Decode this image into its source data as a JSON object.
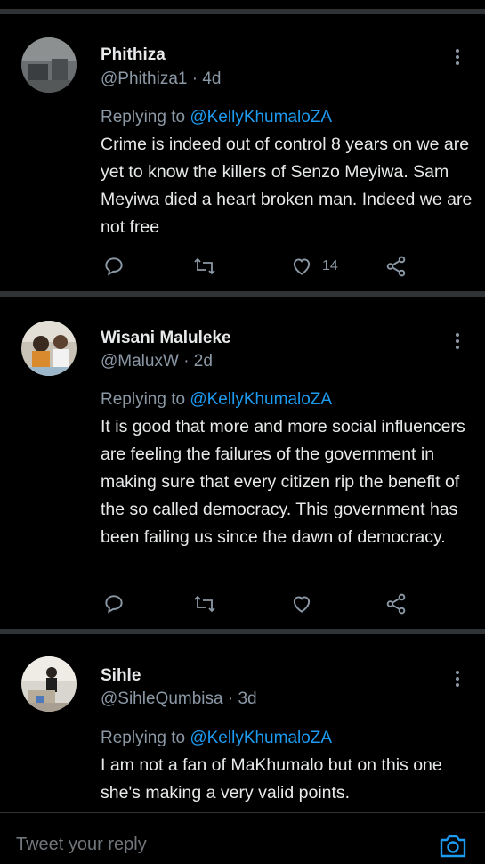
{
  "tweets": [
    {
      "name": "Phithiza",
      "handle": "@Phithiza1",
      "sep": "·",
      "age": "4d",
      "replying_prefix": "Replying to ",
      "replying_handle": "@KellyKhumaloZA",
      "text": "Crime is indeed out of control 8 years on we are yet to know the killers of Senzo Meyiwa. Sam Meyiwa died a heart broken man. Indeed we are not free",
      "like_count": "14"
    },
    {
      "name": "Wisani Maluleke",
      "handle": "@MaluxW",
      "sep": "·",
      "age": "2d",
      "replying_prefix": "Replying to ",
      "replying_handle": "@KellyKhumaloZA",
      "text": "It is good that more and more social influencers are feeling the failures of the government in making sure that every citizen rip the benefit of the so called democracy. This government has been failing us since the dawn of democracy.",
      "like_count": ""
    },
    {
      "name": "Sihle",
      "handle": "@SihleQumbisa",
      "sep": "·",
      "age": "3d",
      "replying_prefix": "Replying to ",
      "replying_handle": "@KellyKhumaloZA",
      "text": "I am not a fan of MaKhumalo but on this one she's making a very valid points.",
      "like_count": ""
    }
  ],
  "reply_bar": {
    "placeholder": "Tweet your reply",
    "camera_icon": "camera-icon"
  },
  "colors": {
    "background": "#000000",
    "separator": "#2f3336",
    "link": "#1d9bf0",
    "secondary_text": "#8b98a5"
  }
}
